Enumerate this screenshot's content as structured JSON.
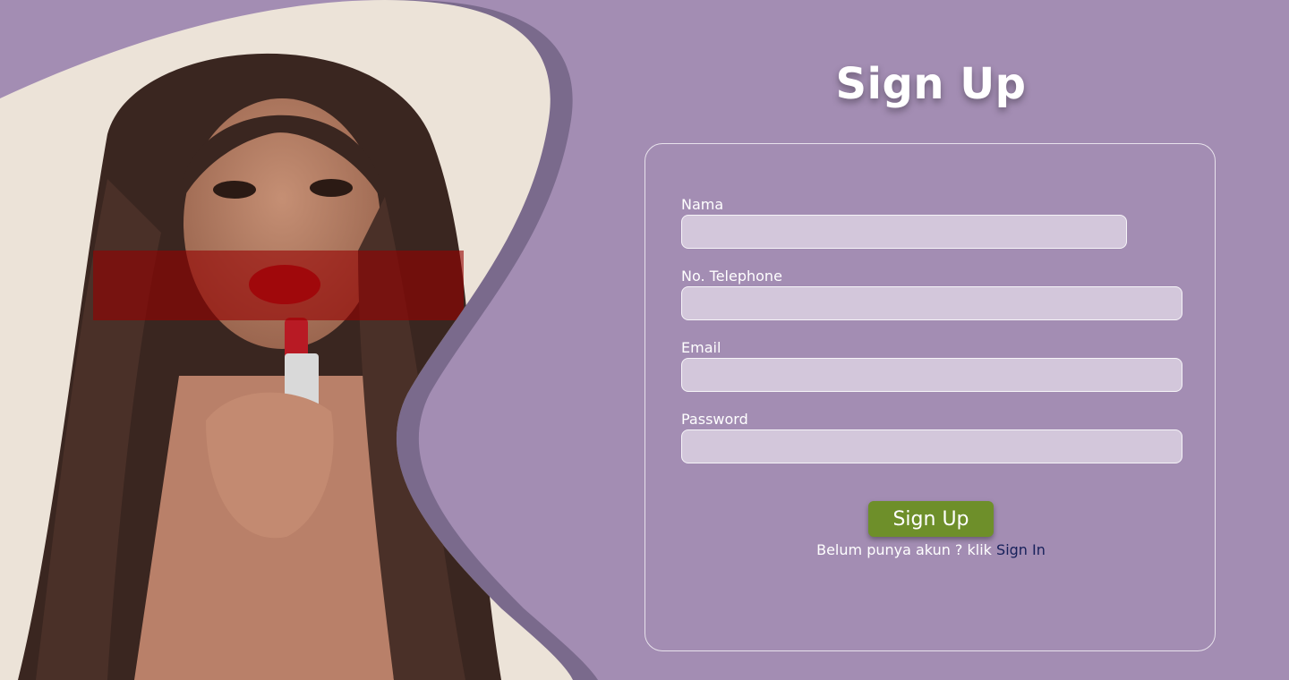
{
  "page": {
    "title": "Sign Up"
  },
  "hero": {
    "image_description": "woman-with-lipstick-photo"
  },
  "form": {
    "fields": [
      {
        "label": "Nama",
        "value": "",
        "placeholder": ""
      },
      {
        "label": "No. Telephone",
        "value": "",
        "placeholder": ""
      },
      {
        "label": "Email",
        "value": "",
        "placeholder": ""
      },
      {
        "label": "Password",
        "value": "",
        "placeholder": ""
      }
    ],
    "submit_label": "Sign Up",
    "footer_text": "Belum punya akun ? klik",
    "footer_link": "Sign In"
  },
  "colors": {
    "background": "#a38db3",
    "input_fill": "#d3c7db",
    "button": "#6e8f2a",
    "link": "#16205a",
    "shape_shadow": "#7a6a8c"
  }
}
